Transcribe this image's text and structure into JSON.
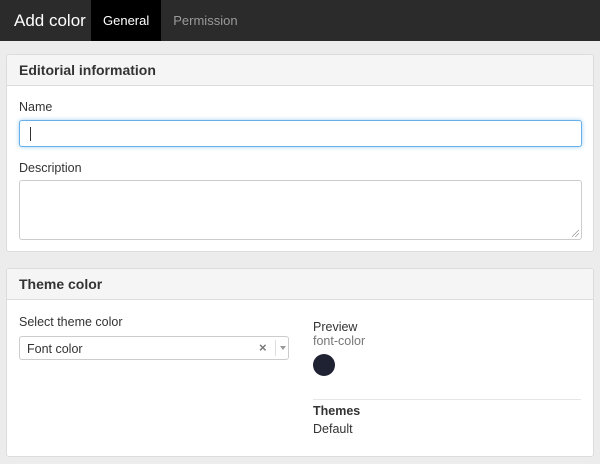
{
  "header": {
    "title": "Add color",
    "tabs": [
      {
        "label": "General",
        "active": true
      },
      {
        "label": "Permission",
        "active": false
      }
    ]
  },
  "editorial": {
    "heading": "Editorial information",
    "name_label": "Name",
    "name_value": "",
    "description_label": "Description",
    "description_value": ""
  },
  "theme": {
    "heading": "Theme color",
    "select_label": "Select theme color",
    "select_value": "Font color",
    "clear_glyph": "×",
    "preview_label": "Preview",
    "preview_name": "font-color",
    "preview_color": "#1f2233",
    "themes_label": "Themes",
    "themes_value": "Default"
  },
  "colors": {
    "topbar": "#2b2b2b",
    "active_tab": "#000000",
    "focus_border": "#66afe9"
  }
}
